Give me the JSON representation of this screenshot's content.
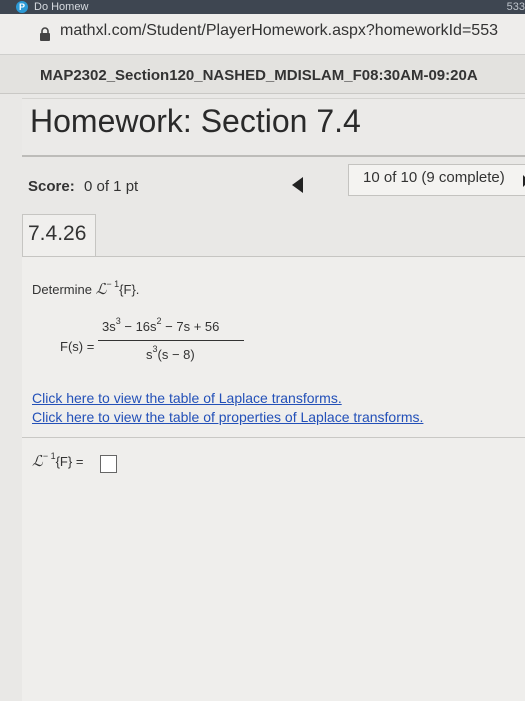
{
  "browser": {
    "tab_title": "Do Homew",
    "url_tail": "533",
    "url": "mathxl.com/Student/PlayerHomework.aspx?homeworkId=553"
  },
  "course": {
    "title": "MAP2302_Section120_NASHED_MDISLAM_F08:30AM-09:20A"
  },
  "homework": {
    "title": "Homework: Section 7.4"
  },
  "score": {
    "label": "Score:",
    "value": "0 of 1 pt"
  },
  "progress": {
    "text": "10 of 10 (9 complete)"
  },
  "question": {
    "number": "7.4.26",
    "determine_prefix": "Determine ",
    "L_symbol": "ℒ",
    "inverse_exp": "− 1",
    "determine_suffix": "{F}.",
    "fs_label": "F(s) =",
    "numerator": {
      "a": "3s",
      "e1": "3",
      "b": " − 16s",
      "e2": "2",
      "c": " − 7s + 56"
    },
    "denominator": {
      "a": "s",
      "e1": "3",
      "b": "(s − 8)"
    },
    "link_laplace_table": "Click here to view the table of Laplace transforms.",
    "link_properties_table": "Click here to view the table of properties of Laplace transforms.",
    "answer_suffix": "{F} ="
  },
  "colors": {
    "link": "#2350b8",
    "tabbar": "#3e4651"
  }
}
